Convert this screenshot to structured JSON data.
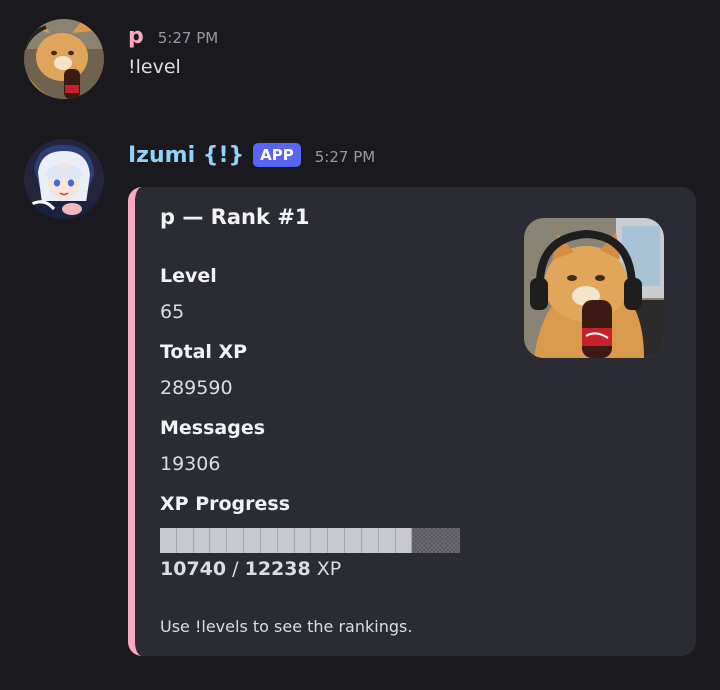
{
  "messages": [
    {
      "author": "p",
      "author_color": "#f9a8bf",
      "timestamp": "5:27 PM",
      "avatar_icon": "orange-cat-avatar",
      "content": "!level"
    },
    {
      "author": "Izumi {!}",
      "author_color": "#8ed4f6",
      "badge": "APP",
      "timestamp": "5:27 PM",
      "avatar_icon": "anime-girl-avatar",
      "embed": {
        "accent_color": "#f9a8bf",
        "title": "p — Rank #1",
        "thumbnail_icon": "orange-cat-headphones-thumbnail",
        "fields": [
          {
            "name": "Level",
            "value": "65"
          },
          {
            "name": "Total XP",
            "value": "289590"
          },
          {
            "name": "Messages",
            "value": "19306"
          },
          {
            "name": "XP Progress",
            "value": ""
          }
        ],
        "progress": {
          "current": "10740",
          "separator": " / ",
          "total": "12238",
          "unit": " XP",
          "fraction": 0.8776,
          "segments_total": 18,
          "segments_filled": 15
        },
        "footer": "Use !levels to see the rankings."
      }
    }
  ]
}
